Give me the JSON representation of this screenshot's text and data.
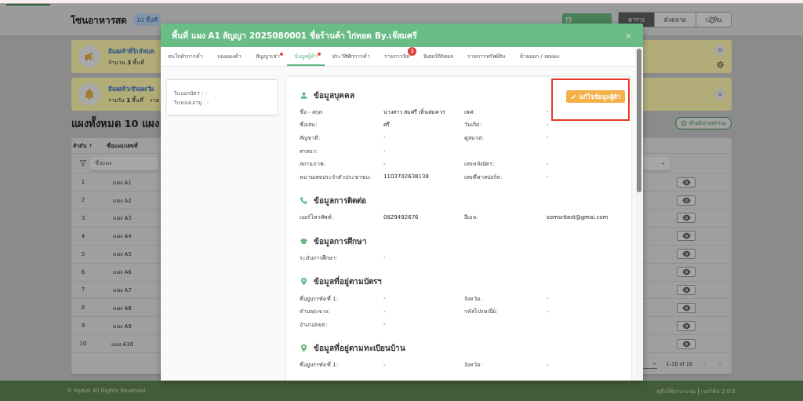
{
  "page": {
    "title": "โซนอาหารสด",
    "badge": "10 พื้นที่",
    "views": [
      {
        "label": "ตาราง",
        "selected": true
      },
      {
        "label": "ผังตลาด",
        "selected": false
      },
      {
        "label": "ปฏิทิน",
        "selected": false
      }
    ],
    "alerts": [
      {
        "kind": "expiring",
        "title": "มีแผงค้าที่ใกล้หมด",
        "lines": [
          "จำนวน **3** พื้นที่"
        ]
      },
      {
        "kind": "entry",
        "title": "มีแผงค้าเข้าแผงวัน",
        "lines": [
          "รายวัน **1** พื้นที่",
          "ราย"
        ]
      }
    ],
    "heading": "แผงทั้งหมด 10 แผง",
    "legend_button": "คำอธิบายสถานะ",
    "table": {
      "columns": [
        "ลำดับ",
        "ชื่อแผง/เลขที่"
      ],
      "filter_placeholder": "ชื่อแผง",
      "rows": [
        {
          "no": "1",
          "name": "แผง A1"
        },
        {
          "no": "2",
          "name": "แผง A2"
        },
        {
          "no": "3",
          "name": "แผง A3"
        },
        {
          "no": "4",
          "name": "แผง A4"
        },
        {
          "no": "5",
          "name": "แผง A5"
        },
        {
          "no": "6",
          "name": "แผง A6"
        },
        {
          "no": "7",
          "name": "แผง A7"
        },
        {
          "no": "8",
          "name": "แผง A8"
        },
        {
          "no": "9",
          "name": "แผง A9"
        },
        {
          "no": "10",
          "name": "แผง A10"
        }
      ],
      "pagination": "1-10 of 10"
    }
  },
  "footer": {
    "copyright": "© MyKet All Rights Reserved.",
    "manual_link": "คู่มือใช้งานระบบ",
    "version": "เวอร์ชั่น 2.0.6"
  },
  "modal": {
    "title": "พื้นที่ แผง A1 สัญญา 2025080001 ชื่อร้านค้า ไก่ทอด By.เจ๊สมศรี",
    "tabs": [
      {
        "label": "สนใจทำการค้า",
        "selected": false,
        "dot": false
      },
      {
        "label": "จองแผงค้า",
        "selected": false,
        "dot": false
      },
      {
        "label": "สัญญาเช่า",
        "selected": false,
        "dot": true
      },
      {
        "label": "ข้อมูลผู้ค้า",
        "selected": true,
        "dot": true
      },
      {
        "label": "ประวัติพักการค้า",
        "selected": false,
        "dot": false
      },
      {
        "label": "รายการบิล",
        "selected": false,
        "dot": false,
        "badge": "3"
      },
      {
        "label": "มิเตอร์ดิจิตอล",
        "selected": false,
        "dot": false
      },
      {
        "label": "รายการทรัพย์สิน",
        "selected": false,
        "dot": false
      },
      {
        "label": "ย้ายออก / ลดแผง",
        "selected": false,
        "dot": false
      }
    ],
    "card_lines": [
      "วันออกบัตร : -",
      "วันหมดอายุ : -"
    ],
    "edit_button": "แก้ไขข้อมูลผู้ค้า",
    "sections": [
      {
        "kind": "personal",
        "title": "ข้อมูลบุคคล",
        "rows": [
          [
            {
              "label": "ชื่อ - สกุล:",
              "value": "นางสาว สมศรี เห็นสมควร"
            },
            {
              "label": "เพศ:",
              "value": "-"
            }
          ],
          [
            {
              "label": "ชื่อเล่น:",
              "value": "ศรี"
            },
            {
              "label": "วันเกิด:",
              "value": "-"
            }
          ],
          [
            {
              "label": "สัญชาติ:",
              "value": "-"
            },
            {
              "label": "คู่สมรส:",
              "value": "-"
            }
          ],
          [
            {
              "label": "ศาสนา:",
              "value": "-"
            }
          ],
          [
            {
              "label": "สถานภาพ:",
              "value": "-"
            },
            {
              "label": "เลขหลังบัตร:",
              "value": "-"
            }
          ],
          [
            {
              "label": "หมายเลขประจำตัวประชาชน:",
              "value": "1103702638138"
            },
            {
              "label": "เลขที่พาสปอร์ต:",
              "value": "-"
            }
          ]
        ]
      },
      {
        "kind": "contact",
        "title": "ข้อมูลการติดต่อ",
        "rows": [
          [
            {
              "label": "เบอร์โทรศัพท์:",
              "value": "0829492676"
            },
            {
              "label": "อีเมล:",
              "value": "somsritest@gmai.com"
            }
          ]
        ]
      },
      {
        "kind": "education",
        "title": "ข้อมูลการศึกษา",
        "rows": [
          [
            {
              "label": "ระดับการศึกษา:",
              "value": "-"
            }
          ]
        ]
      },
      {
        "kind": "address",
        "title": "ข้อมูลที่อยู่ตามบัตรฯ",
        "rows": [
          [
            {
              "label": "ที่อยู่บรรทัดที่ 1:",
              "value": "-"
            },
            {
              "label": "จังหวัด:",
              "value": "-"
            }
          ],
          [
            {
              "label": "ตำบล/แขวง:",
              "value": "-"
            },
            {
              "label": "รหัสไปรษณีย์:",
              "value": "-"
            }
          ],
          [
            {
              "label": "อำเภอ/เขต:",
              "value": "-"
            }
          ]
        ]
      },
      {
        "kind": "address",
        "title": "ข้อมูลที่อยู่ตามทะเบียนบ้าน",
        "rows": [
          [
            {
              "label": "ที่อยู่บรรทัดที่ 1:",
              "value": "-"
            },
            {
              "label": "จังหวัด:",
              "value": "-"
            }
          ]
        ]
      }
    ]
  }
}
